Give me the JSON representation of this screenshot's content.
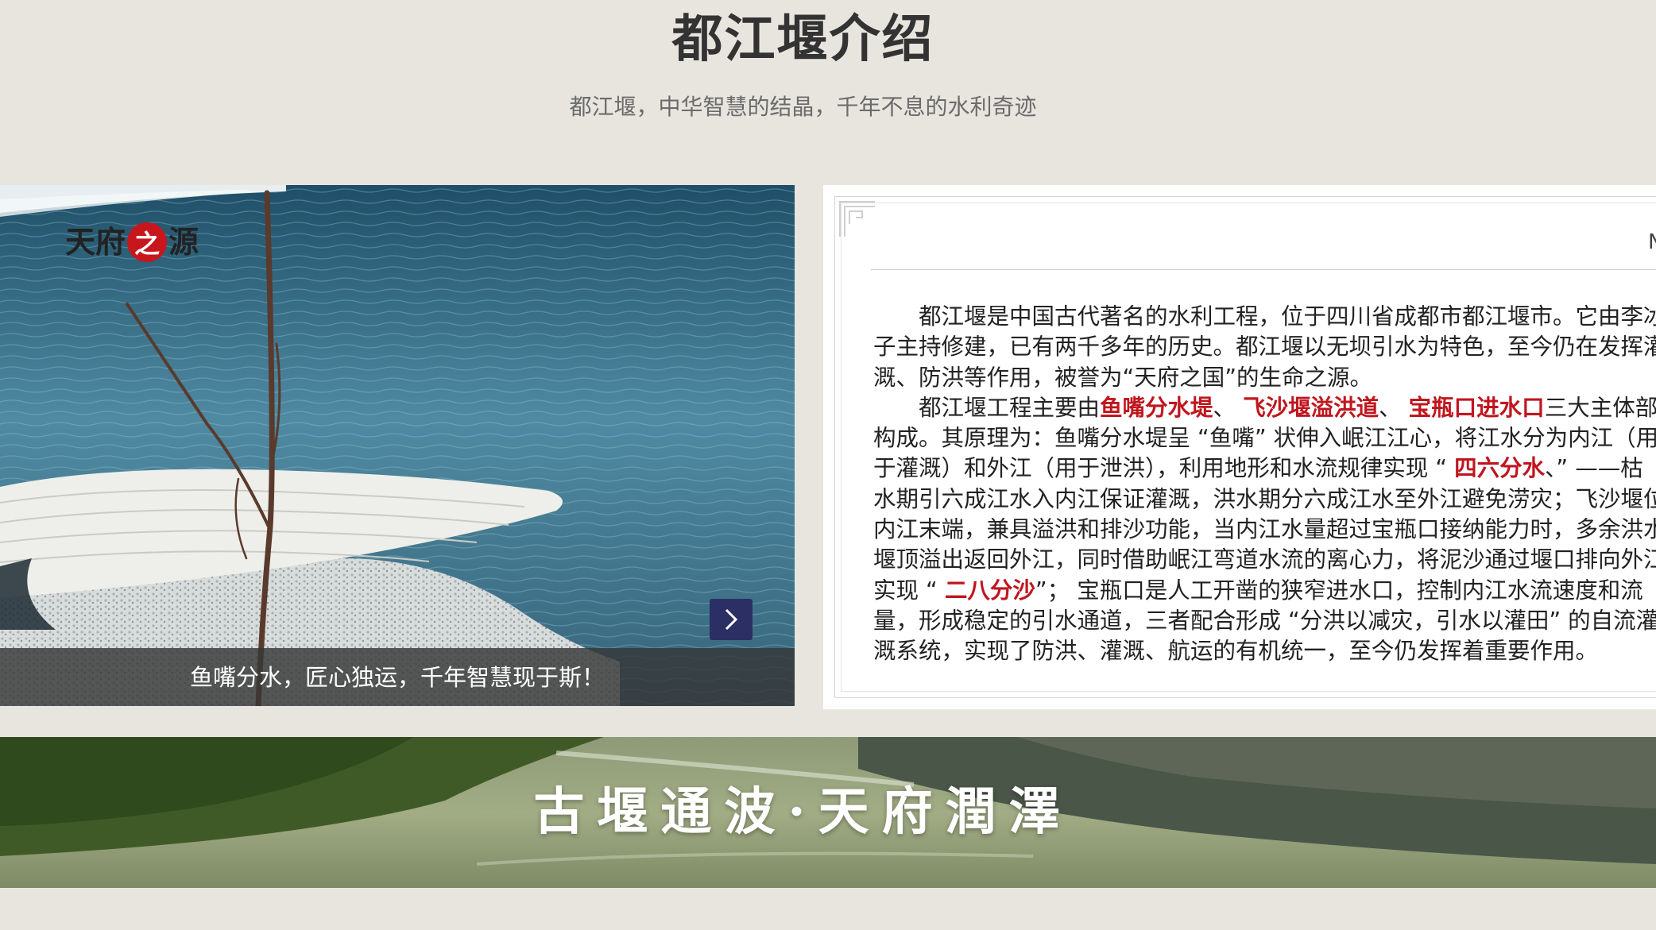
{
  "header": {
    "title": "都江堰介绍",
    "subtitle": "都江堰，中华智慧的结晶，千年不息的水利奇迹"
  },
  "carousel": {
    "caption": "鱼嘴分水，匠心独运，千年智慧现于斯！",
    "next_icon": "chevron-right-icon"
  },
  "intro_card": {
    "brand": {
      "char1": "天",
      "char2": "府",
      "seal_char": "之",
      "char3": "源"
    },
    "edge_letter": "N",
    "lines": [
      [
        {
          "t": "　　都江堰是中国古代著名的水利工程，位于四川省成都市都江堰市。它由李冰"
        }
      ],
      [
        {
          "t": "子主持修建，已有两千多年的历史。都江堰以无坝引水为特色，至今仍在发挥灌"
        }
      ],
      [
        {
          "t": "溉、防洪等作用，被誉为“天府之国”的生命之源。"
        }
      ],
      [
        {
          "t": "　　都江堰工程主要由"
        },
        {
          "t": "鱼嘴分水堤",
          "hl": true
        },
        {
          "t": "、 "
        },
        {
          "t": "飞沙堰溢洪道",
          "hl": true
        },
        {
          "t": "、 "
        },
        {
          "t": "宝瓶口进水口",
          "hl": true
        },
        {
          "t": "三大主体部分"
        }
      ],
      [
        {
          "t": "构成。其原理为：鱼嘴分水堤呈 “鱼嘴” 状伸入岷江江心，将江水分为内江（用"
        }
      ],
      [
        {
          "t": "于灌溉）和外江（用于泄洪），利用地形和水流规律实现 “ "
        },
        {
          "t": "四六分水",
          "hl": true
        },
        {
          "t": "、” ——枯"
        }
      ],
      [
        {
          "t": "水期引六成江水入内江保证灌溉，洪水期分六成江水至外江避免涝灾；飞沙堰位于"
        }
      ],
      [
        {
          "t": "内江末端，兼具溢洪和排沙功能，当内江水量超过宝瓶口接纳能力时，多余洪水从"
        }
      ],
      [
        {
          "t": "堰顶溢出返回外江，同时借助岷江弯道水流的离心力，将泥沙通过堰口排向外江，"
        }
      ],
      [
        {
          "t": "实现 “ "
        },
        {
          "t": "二八分沙",
          "hl": true
        },
        {
          "t": "”； 宝瓶口是人工开凿的狭窄进水口，控制内江水流速度和流"
        }
      ],
      [
        {
          "t": "量，形成稳定的引水通道，三者配合形成 “分洪以减灾，引水以灌田” 的自流灌"
        }
      ],
      [
        {
          "t": "溉系统，实现了防洪、灌溉、航运的有机统一，至今仍发挥着重要作用。"
        }
      ]
    ]
  },
  "banner": {
    "slogan": "古堰通波·天府潤澤"
  },
  "colors": {
    "page_bg": "#e8e5df",
    "title": "#333333",
    "subtitle": "#6b6b6b",
    "highlight": "#c0161e",
    "seal": "#c8161d",
    "nav_button": "#2b2f63"
  }
}
